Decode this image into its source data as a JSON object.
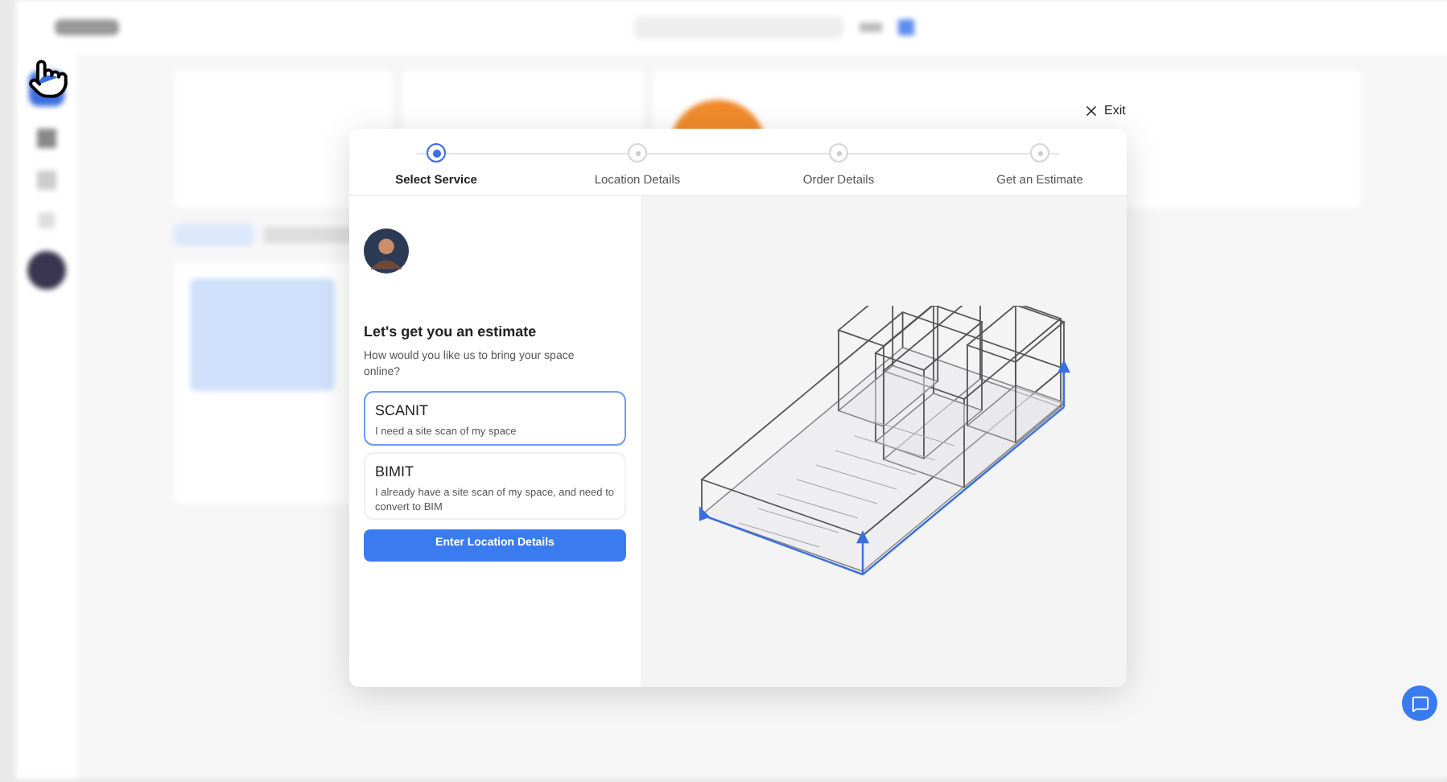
{
  "modal": {
    "exit": "Exit",
    "steps": [
      {
        "label": "Select Service",
        "selected": true
      },
      {
        "label": "Location Details",
        "selected": false
      },
      {
        "label": "Order Details",
        "selected": false
      },
      {
        "label": "Get an Estimate",
        "selected": false
      }
    ],
    "heading": "Let's get you an estimate",
    "subtitle": "How would you like us to bring your space online?",
    "options": [
      {
        "title": "SCANIT",
        "description": "I need a site scan of my space",
        "selected": true
      },
      {
        "title": "BIMIT",
        "description": "I already have a site scan of my space, and need to convert to BIM",
        "selected": false
      }
    ],
    "button": "Enter Location Details"
  }
}
